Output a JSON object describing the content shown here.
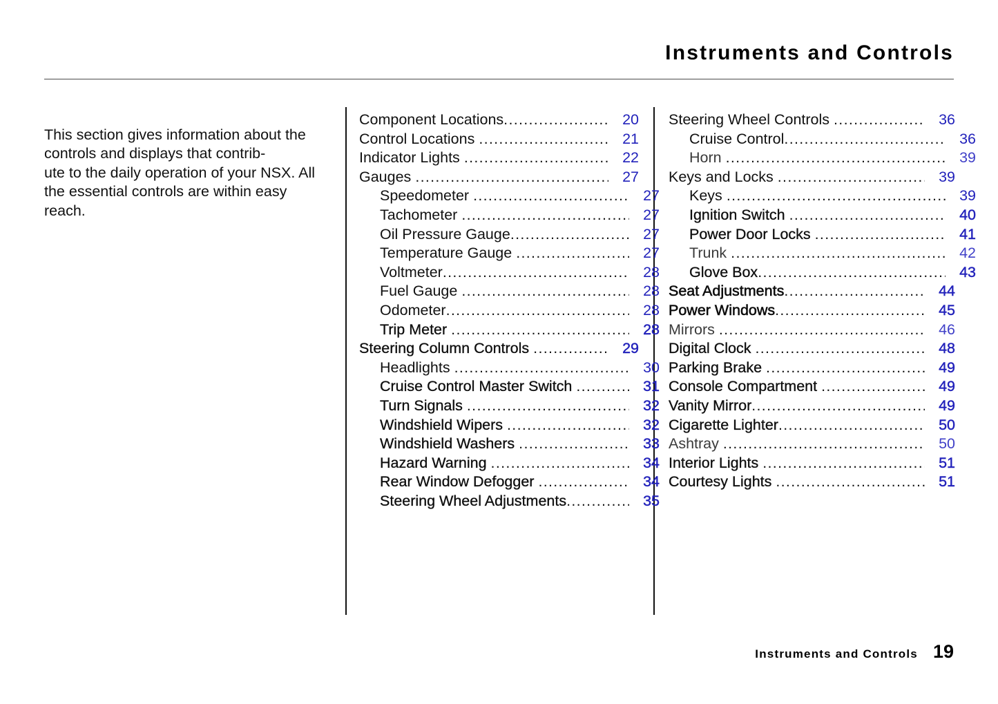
{
  "header": {
    "title": "Instruments  and  Controls"
  },
  "intro": {
    "text": "This section gives information about the controls and displays that contrib-\nute to the daily operation of your NSX. All the essential controls are within easy reach."
  },
  "toc": {
    "column1": [
      {
        "label": "Component Locations",
        "page": "20",
        "level": 1,
        "weight": "normal",
        "tight": true
      },
      {
        "label": "Control Locations",
        "page": "21",
        "level": 1,
        "weight": "normal",
        "tight": false
      },
      {
        "label": "Indicator Lights",
        "page": "22",
        "level": 1,
        "weight": "normal",
        "tight": false
      },
      {
        "label": "Gauges",
        "page": "27",
        "level": 1,
        "weight": "normal",
        "tight": false
      },
      {
        "label": "Speedometer",
        "page": "27",
        "level": 2,
        "weight": "normal",
        "tight": false
      },
      {
        "label": "Tachometer",
        "page": "27",
        "level": 2,
        "weight": "normal",
        "tight": false
      },
      {
        "label": "Oil Pressure Gauge",
        "page": "27",
        "level": 2,
        "weight": "normal",
        "tight": true
      },
      {
        "label": "Temperature Gauge",
        "page": "27",
        "level": 2,
        "weight": "normal",
        "tight": false
      },
      {
        "label": "Voltmeter",
        "page": "28",
        "level": 2,
        "weight": "normal",
        "tight": true
      },
      {
        "label": "Fuel Gauge",
        "page": "28",
        "level": 2,
        "weight": "normal",
        "tight": false
      },
      {
        "label": "Odometer",
        "page": "28",
        "level": 2,
        "weight": "normal",
        "tight": true
      },
      {
        "label": "Trip Meter",
        "page": "28",
        "level": 2,
        "weight": "semi",
        "tight": false
      },
      {
        "label": "Steering Column Controls",
        "page": "29",
        "level": 1,
        "weight": "semi",
        "tight": false
      },
      {
        "label": "Headlights",
        "page": "30",
        "level": 2,
        "weight": "normal",
        "tight": false
      },
      {
        "label": "Cruise Control Master Switch",
        "page": "31",
        "level": 2,
        "weight": "semi",
        "tight": false
      },
      {
        "label": "Turn Signals",
        "page": "32",
        "level": 2,
        "weight": "semi",
        "tight": false
      },
      {
        "label": "Windshield Wipers",
        "page": "32",
        "level": 2,
        "weight": "semi",
        "tight": false
      },
      {
        "label": "Windshield Washers",
        "page": "33",
        "level": 2,
        "weight": "semi",
        "tight": false
      },
      {
        "label": "Hazard Warning",
        "page": "34",
        "level": 2,
        "weight": "semi",
        "tight": false
      },
      {
        "label": "Rear Window Defogger",
        "page": "34",
        "level": 2,
        "weight": "semi",
        "tight": false
      },
      {
        "label": "Steering Wheel Adjustments",
        "page": "35",
        "level": 2,
        "weight": "semi",
        "tight": true
      }
    ],
    "column2": [
      {
        "label": "Steering Wheel Controls",
        "page": "36",
        "level": 1,
        "weight": "normal",
        "tight": false
      },
      {
        "label": "Cruise Control",
        "page": "36",
        "level": 2,
        "weight": "normal",
        "tight": true
      },
      {
        "label": "Horn",
        "page": "39",
        "level": 2,
        "weight": "light",
        "tight": false
      },
      {
        "label": "Keys and Locks",
        "page": "39",
        "level": 1,
        "weight": "normal",
        "tight": false
      },
      {
        "label": "Keys",
        "page": "39",
        "level": 2,
        "weight": "normal",
        "tight": false
      },
      {
        "label": "Ignition Switch",
        "page": "40",
        "level": 2,
        "weight": "semi",
        "tight": false
      },
      {
        "label": "Power Door Locks",
        "page": "41",
        "level": 2,
        "weight": "semi",
        "tight": false
      },
      {
        "label": "Trunk",
        "page": "42",
        "level": 2,
        "weight": "light",
        "tight": false
      },
      {
        "label": "Glove Box",
        "page": "43",
        "level": 2,
        "weight": "semi",
        "tight": true
      },
      {
        "label": "Seat Adjustments",
        "page": "44",
        "level": 1,
        "weight": "bold",
        "tight": true
      },
      {
        "label": "Power Windows",
        "page": "45",
        "level": 1,
        "weight": "bold",
        "tight": true
      },
      {
        "label": "Mirrors",
        "page": "46",
        "level": 1,
        "weight": "light",
        "tight": false
      },
      {
        "label": "Digital Clock",
        "page": "48",
        "level": 1,
        "weight": "semi",
        "tight": false
      },
      {
        "label": "Parking Brake",
        "page": "49",
        "level": 1,
        "weight": "semi",
        "tight": false
      },
      {
        "label": "Console Compartment",
        "page": "49",
        "level": 1,
        "weight": "semi",
        "tight": false
      },
      {
        "label": "Vanity Mirror",
        "page": "49",
        "level": 1,
        "weight": "semi",
        "tight": true
      },
      {
        "label": "Cigarette Lighter",
        "page": "50",
        "level": 1,
        "weight": "semi",
        "tight": true
      },
      {
        "label": "Ashtray",
        "page": "50",
        "level": 1,
        "weight": "light",
        "tight": false
      },
      {
        "label": "Interior Lights",
        "page": "51",
        "level": 1,
        "weight": "semi",
        "tight": false
      },
      {
        "label": "Courtesy Lights",
        "page": "51",
        "level": 1,
        "weight": "semi",
        "tight": false
      }
    ]
  },
  "footer": {
    "title": "Instruments  and  Controls",
    "page_number": "19"
  }
}
